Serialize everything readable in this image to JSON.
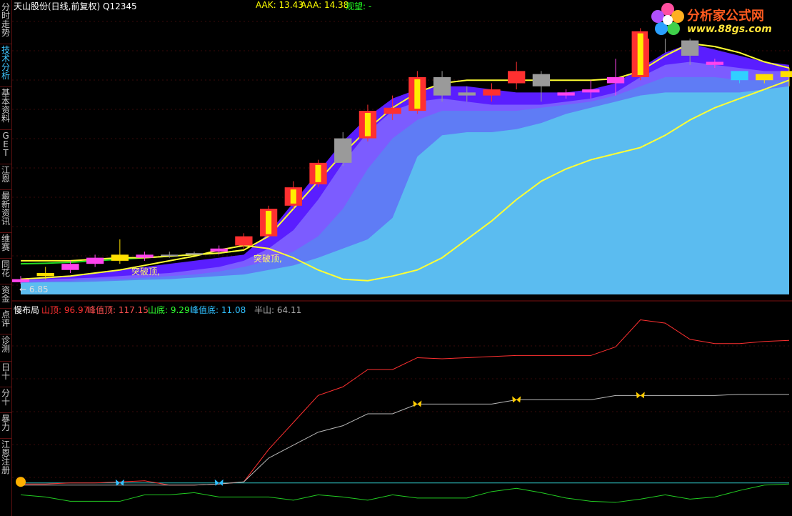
{
  "sidebar": {
    "items": [
      {
        "label": "分\n时\n走\n势",
        "active": false
      },
      {
        "label": "技\n术\n分\n析",
        "active": true
      },
      {
        "label": "基\n本\n资\n料",
        "active": false
      },
      {
        "label": "G\nE\nT",
        "active": false
      },
      {
        "label": "江\n恩",
        "active": false
      },
      {
        "label": "最\n新\n资\n讯",
        "active": false
      },
      {
        "label": "维\n赛",
        "active": false
      },
      {
        "label": "同\n花",
        "active": false
      },
      {
        "label": "资\n金",
        "active": false
      },
      {
        "label": "点\n评",
        "active": false
      },
      {
        "label": "诊\n测",
        "active": false
      },
      {
        "label": "日\n十",
        "active": false
      },
      {
        "label": "分\n十",
        "active": false
      },
      {
        "label": "暴\n力",
        "active": false
      },
      {
        "label": "江\n恩\n注\n册",
        "active": false
      }
    ]
  },
  "header": {
    "title": "天山股份(日线,前复权) Q12345",
    "aak": "AAK: 13.43",
    "aaa": "AAA: 14.38",
    "watch": "观望: -"
  },
  "logo": {
    "brand": "分析家公式网",
    "url": "www.88gs.com"
  },
  "price_labels": {
    "low": "← 6.85",
    "breakout1": "突破顶,",
    "breakout2": "突破顶,"
  },
  "lower_header": {
    "name": "慢布局",
    "shanding": "山顶: 96.97",
    "fengzhiding": "峰值顶: 117.15",
    "shandi": "山底: 9.29",
    "fengzhidi": "峰值底: 11.08",
    "banshan": "半山: 64.11"
  },
  "colors": {
    "up": "#ff3030",
    "yellow": "#ffff33",
    "cyan": "#30d0ff",
    "band1": "#5a1eff",
    "band2": "#7c5cff",
    "band3": "#5f7cf5",
    "band4": "#5bbcf0"
  },
  "chart_data": {
    "type": "candlestick",
    "candles": [
      {
        "o": 6.9,
        "h": 7.1,
        "l": 6.85,
        "c": 7.0,
        "color": "magenta"
      },
      {
        "o": 7.1,
        "h": 7.4,
        "l": 7.0,
        "c": 7.2,
        "color": "yellow"
      },
      {
        "o": 7.3,
        "h": 7.6,
        "l": 7.2,
        "c": 7.5,
        "color": "magenta"
      },
      {
        "o": 7.5,
        "h": 7.8,
        "l": 7.4,
        "c": 7.7,
        "color": "magenta"
      },
      {
        "o": 7.8,
        "h": 8.3,
        "l": 7.5,
        "c": 7.6,
        "color": "yellow"
      },
      {
        "o": 7.7,
        "h": 7.9,
        "l": 7.6,
        "c": 7.8,
        "color": "magenta"
      },
      {
        "o": 7.8,
        "h": 7.9,
        "l": 7.7,
        "c": 7.8,
        "color": "gray"
      },
      {
        "o": 7.8,
        "h": 7.9,
        "l": 7.8,
        "c": 7.85,
        "color": "gray"
      },
      {
        "o": 7.9,
        "h": 8.1,
        "l": 7.8,
        "c": 8.0,
        "color": "magenta"
      },
      {
        "o": 8.1,
        "h": 8.5,
        "l": 8.0,
        "c": 8.4,
        "color": "red"
      },
      {
        "o": 8.4,
        "h": 9.4,
        "l": 8.4,
        "c": 9.3,
        "color": "red"
      },
      {
        "o": 9.4,
        "h": 10.2,
        "l": 9.3,
        "c": 10.0,
        "color": "red"
      },
      {
        "o": 10.1,
        "h": 10.9,
        "l": 10.0,
        "c": 10.8,
        "color": "red"
      },
      {
        "o": 10.8,
        "h": 11.8,
        "l": 10.7,
        "c": 11.6,
        "color": "gray"
      },
      {
        "o": 11.6,
        "h": 12.7,
        "l": 11.5,
        "c": 12.5,
        "color": "red"
      },
      {
        "o": 12.6,
        "h": 13.0,
        "l": 12.2,
        "c": 12.4,
        "color": "red"
      },
      {
        "o": 12.5,
        "h": 13.8,
        "l": 12.4,
        "c": 13.6,
        "color": "red"
      },
      {
        "o": 13.6,
        "h": 13.8,
        "l": 12.8,
        "c": 13.0,
        "color": "gray"
      },
      {
        "o": 13.0,
        "h": 13.3,
        "l": 12.8,
        "c": 13.1,
        "color": "gray"
      },
      {
        "o": 13.0,
        "h": 13.4,
        "l": 12.8,
        "c": 13.2,
        "color": "red"
      },
      {
        "o": 13.4,
        "h": 14.1,
        "l": 13.2,
        "c": 13.8,
        "color": "red"
      },
      {
        "o": 13.7,
        "h": 13.8,
        "l": 12.8,
        "c": 13.3,
        "color": "gray"
      },
      {
        "o": 13.1,
        "h": 13.2,
        "l": 12.9,
        "c": 13.0,
        "color": "magenta"
      },
      {
        "o": 13.2,
        "h": 13.5,
        "l": 12.9,
        "c": 13.1,
        "color": "magenta"
      },
      {
        "o": 13.4,
        "h": 14.2,
        "l": 13.0,
        "c": 13.6,
        "color": "magenta"
      },
      {
        "o": 13.6,
        "h": 15.2,
        "l": 13.5,
        "c": 15.1,
        "color": "red"
      },
      {
        "o": 15.0,
        "h": 15.3,
        "l": 14.4,
        "c": 15.3,
        "color": "gray"
      },
      {
        "o": 14.8,
        "h": 14.9,
        "l": 14.0,
        "c": 14.3,
        "color": "gray"
      },
      {
        "o": 14.0,
        "h": 14.2,
        "l": 13.9,
        "c": 14.1,
        "color": "magenta"
      },
      {
        "o": 13.5,
        "h": 13.8,
        "l": 13.4,
        "c": 13.8,
        "color": "cyan"
      },
      {
        "o": 13.5,
        "h": 13.7,
        "l": 13.4,
        "c": 13.7,
        "color": "yellow"
      },
      {
        "o": 13.6,
        "h": 13.9,
        "l": 13.3,
        "c": 13.8,
        "color": "yellow"
      }
    ],
    "yellow_upper": [
      7.6,
      7.6,
      7.6,
      7.65,
      7.7,
      7.7,
      7.75,
      7.8,
      7.85,
      7.95,
      8.4,
      9.3,
      10.2,
      11.1,
      11.9,
      12.6,
      13.1,
      13.4,
      13.5,
      13.5,
      13.5,
      13.5,
      13.5,
      13.5,
      13.55,
      13.8,
      14.3,
      14.7,
      14.6,
      14.4,
      14.1,
      13.9
    ],
    "yellow_lower": [
      7.0,
      7.05,
      7.1,
      7.2,
      7.3,
      7.45,
      7.6,
      7.75,
      7.95,
      8.1,
      8.0,
      7.7,
      7.3,
      7.0,
      6.95,
      7.1,
      7.3,
      7.7,
      8.3,
      8.9,
      9.6,
      10.2,
      10.6,
      10.9,
      11.1,
      11.3,
      11.7,
      12.2,
      12.6,
      12.9,
      13.2,
      13.5
    ],
    "green_line": [
      7.5,
      7.52,
      7.55,
      7.6,
      7.65,
      7.7,
      7.75,
      7.8,
      7.85,
      7.95
    ],
    "band_top": [
      7.0,
      7.05,
      7.1,
      7.2,
      7.3,
      7.4,
      7.5,
      7.6,
      7.7,
      7.8,
      8.5,
      9.5,
      10.5,
      11.5,
      12.3,
      12.9,
      13.2,
      13.3,
      13.3,
      13.2,
      13.1,
      13.1,
      13.1,
      13.2,
      13.4,
      13.9,
      14.4,
      14.7,
      14.5,
      14.3,
      14.1,
      14.0
    ],
    "band2_top": [
      6.95,
      7.0,
      7.02,
      7.05,
      7.1,
      7.15,
      7.2,
      7.3,
      7.4,
      7.6,
      8.0,
      8.6,
      9.6,
      10.8,
      11.8,
      12.5,
      12.8,
      12.9,
      12.8,
      12.7,
      12.7,
      12.7,
      12.8,
      12.9,
      13.1,
      13.6,
      14.0,
      14.1,
      14.0,
      13.9,
      13.8,
      13.8
    ],
    "band3_top": [
      6.9,
      6.92,
      6.95,
      7.0,
      7.0,
      7.05,
      7.1,
      7.15,
      7.25,
      7.4,
      7.6,
      7.9,
      8.4,
      9.3,
      10.6,
      11.6,
      12.2,
      12.5,
      12.5,
      12.5,
      12.5,
      12.6,
      12.7,
      12.8,
      13.0,
      13.3,
      13.6,
      13.6,
      13.6,
      13.5,
      13.5,
      13.5
    ],
    "band4_top": [
      6.88,
      6.9,
      6.9,
      6.92,
      6.95,
      6.98,
      7.0,
      7.05,
      7.1,
      7.15,
      7.3,
      7.45,
      7.7,
      8.0,
      8.3,
      9.0,
      11.0,
      11.7,
      11.8,
      11.8,
      11.9,
      12.1,
      12.4,
      12.6,
      12.8,
      13.0,
      13.1,
      13.1,
      13.1,
      13.1,
      13.2,
      13.3
    ],
    "lower_red": [
      -2,
      -2,
      -1,
      -1,
      0,
      1,
      -3,
      -3,
      -2,
      0,
      30,
      55,
      80,
      88,
      104,
      104,
      115,
      114,
      115,
      116,
      117,
      117,
      117,
      117,
      125,
      150,
      147,
      132,
      128,
      128,
      130,
      131
    ],
    "lower_gray": [
      -3,
      -3,
      -3,
      -3,
      -3,
      -3,
      -3,
      -3,
      -2,
      0,
      22,
      34,
      46,
      52,
      63,
      63,
      72,
      72,
      72,
      72,
      76,
      76,
      76,
      76,
      80,
      80,
      80,
      80,
      80,
      81,
      81,
      81
    ],
    "lower_cyan": [
      -1,
      -1,
      -1,
      -1,
      -1,
      -1,
      -1,
      -1,
      -1,
      -1,
      -1,
      -1,
      -1,
      -1,
      -1,
      -1,
      -1,
      -1,
      -1,
      -1,
      -1,
      -1,
      -1,
      -1,
      -1,
      -1,
      -1,
      -1,
      -1,
      -1,
      -1,
      -1
    ],
    "lower_green": [
      -12,
      -14,
      -18,
      -18,
      -18,
      -12,
      -12,
      -10,
      -14,
      -14,
      -14,
      -17,
      -12,
      -14,
      -17,
      -12,
      -15,
      -15,
      -15,
      -9,
      -6,
      -10,
      -15,
      -18,
      -19,
      -16,
      -12,
      -16,
      -14,
      -8,
      -3,
      -2
    ],
    "lower_ylim": [
      -25,
      155
    ],
    "main_ylim": [
      6.5,
      15.7
    ]
  }
}
